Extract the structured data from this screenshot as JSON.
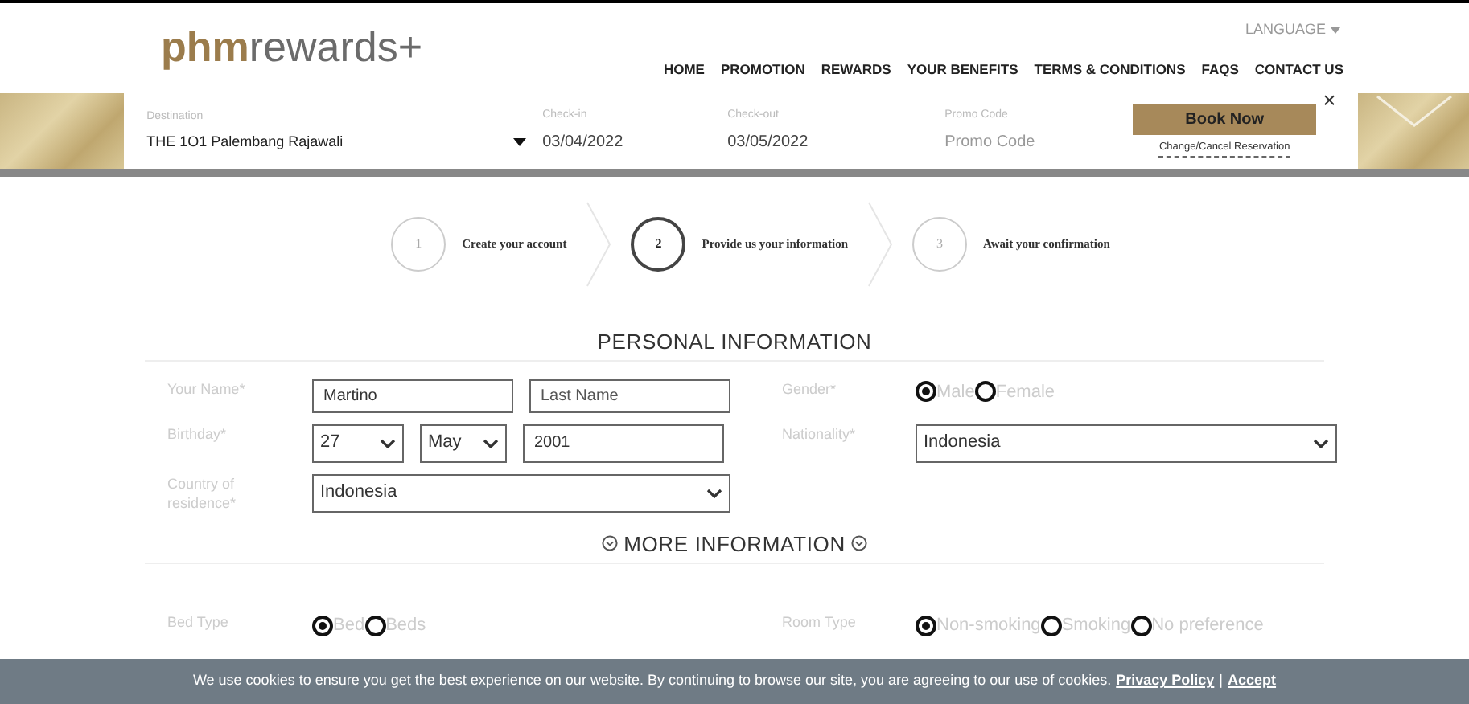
{
  "header": {
    "logo_bold": "phm",
    "logo_rest": "rewards+",
    "language": "LANGUAGE",
    "nav": [
      "HOME",
      "PROMOTION",
      "REWARDS",
      "YOUR BENEFITS",
      "TERMS & CONDITIONS",
      "FAQS",
      "CONTACT US"
    ]
  },
  "booking": {
    "destination": {
      "label": "Destination",
      "value": "THE 1O1 Palembang Rajawali"
    },
    "check_in": {
      "label": "Check-in",
      "value": "03/04/2022"
    },
    "check_out": {
      "label": "Check-out",
      "value": "03/05/2022"
    },
    "promo": {
      "label": "Promo Code",
      "placeholder": "Promo Code"
    },
    "book_button": "Book Now",
    "change_link": "Change/Cancel Reservation",
    "close": "×"
  },
  "steps": [
    {
      "number": "1",
      "label": "Create your account",
      "selected": false
    },
    {
      "number": "2",
      "label": "Provide us your information",
      "selected": true
    },
    {
      "number": "3",
      "label": "Await your confirmation",
      "selected": false
    }
  ],
  "personal": {
    "title": "PERSONAL INFORMATION",
    "name_label": "Your Name*",
    "first_name": "Martino",
    "last_name_placeholder": "Last Name",
    "gender_label": "Gender*",
    "genders": [
      {
        "label": "Male",
        "selected": true
      },
      {
        "label": "Female",
        "selected": false
      }
    ],
    "birthday_label": "Birthday*",
    "day": "27",
    "month": "May",
    "year": "2001",
    "nationality_label": "Nationality*",
    "nationality": "Indonesia",
    "country_label": "Country of residence*",
    "country": "Indonesia"
  },
  "more": {
    "title": "MORE INFORMATION",
    "bed_label": "Bed Type",
    "beds": [
      {
        "label": "Bed",
        "selected": true
      },
      {
        "label": "Beds",
        "selected": false
      }
    ],
    "room_label": "Room Type",
    "rooms": [
      {
        "label": "Non-smoking",
        "selected": true
      },
      {
        "label": "Smoking",
        "selected": false
      },
      {
        "label": "No preference",
        "selected": false
      }
    ]
  },
  "cookie": {
    "text": "We use cookies to ensure you get the best experience on our website. By continuing to browse our site, you are agreeing to our use of cookies.",
    "privacy": "Privacy Policy",
    "separator": "|",
    "accept": "Accept"
  }
}
